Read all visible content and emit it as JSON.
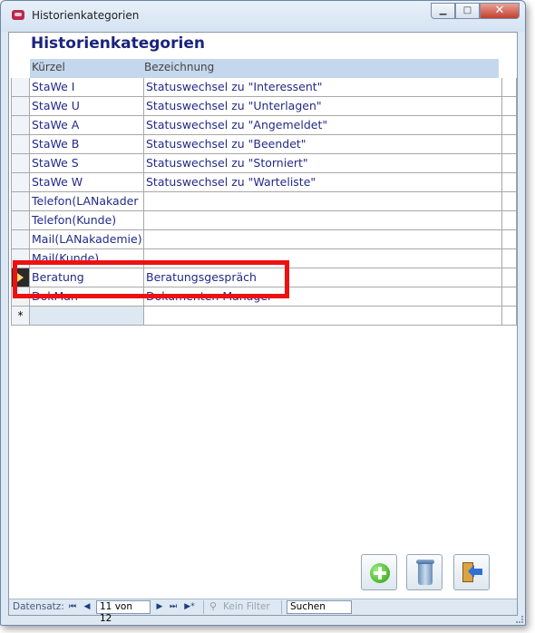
{
  "window": {
    "title": "Historienkategorien",
    "buttons": {
      "minimize": "▁",
      "maximize": "□",
      "close": "✕"
    }
  },
  "form": {
    "title": "Historienkategorien"
  },
  "grid": {
    "columns": [
      "Kürzel",
      "Bezeichnung"
    ],
    "rows": [
      {
        "kuerzel": "StaWe I",
        "bezeichnung": "Statuswechsel zu \"Interessent\""
      },
      {
        "kuerzel": "StaWe U",
        "bezeichnung": "Statuswechsel zu \"Unterlagen\""
      },
      {
        "kuerzel": "StaWe A",
        "bezeichnung": "Statuswechsel zu \"Angemeldet\""
      },
      {
        "kuerzel": "StaWe B",
        "bezeichnung": "Statuswechsel zu \"Beendet\""
      },
      {
        "kuerzel": "StaWe S",
        "bezeichnung": "Statuswechsel zu \"Storniert\""
      },
      {
        "kuerzel": "StaWe W",
        "bezeichnung": "Statuswechsel zu \"Warteliste\""
      },
      {
        "kuerzel": "Telefon(LANakader",
        "bezeichnung": ""
      },
      {
        "kuerzel": "Telefon(Kunde)",
        "bezeichnung": ""
      },
      {
        "kuerzel": "Mail(LANakademie)",
        "bezeichnung": ""
      },
      {
        "kuerzel": "Mail(Kunde)",
        "bezeichnung": ""
      },
      {
        "kuerzel": "Beratung",
        "bezeichnung": "Beratungsgespräch"
      },
      {
        "kuerzel": "DokMan",
        "bezeichnung": "Dokumenten Manager"
      }
    ],
    "new_row_marker": "*"
  },
  "buttons": {
    "add": "add-icon",
    "delete": "trash-icon",
    "exit": "exit-door-icon"
  },
  "navigation": {
    "label": "Datensatz:",
    "first": "⏮",
    "prev": "◀",
    "position": "11 von 12",
    "next": "▶",
    "last": "⏭",
    "new": "▶*",
    "filter_label": "Kein Filter",
    "search_label": "Suchen"
  },
  "colors": {
    "title_text": "#1a237e",
    "highlight": "#ee1111",
    "header_bg": "#c5d7ec"
  }
}
